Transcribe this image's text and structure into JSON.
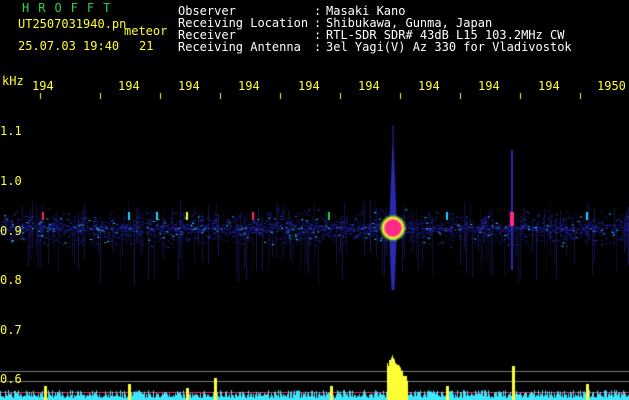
{
  "header": {
    "app_title": "HROFFT",
    "file_name": "UT2507031940.pn",
    "file_suffix": "meteor",
    "timestamp": "25.07.03 19:40",
    "counter": "21",
    "meta": [
      {
        "key": "Observer",
        "value": "Masaki Kano"
      },
      {
        "key": "Receiving Location",
        "value": "Shibukawa, Gunma, Japan"
      },
      {
        "key": "Receiver",
        "value": "RTL-SDR SDR# 43dB L15 103.2MHz CW"
      },
      {
        "key": "Receiving Antenna",
        "value": "3el Yagi(V) Az 330 for Vladivostok"
      }
    ]
  },
  "axes": {
    "y_unit": "kHz",
    "y_ticks": [
      "1.1",
      "1.0",
      "0.9",
      "0.8",
      "0.7",
      "0.6"
    ],
    "x_ticks": [
      "194",
      "194",
      "194",
      "194",
      "194",
      "194",
      "194",
      "194",
      "194",
      "1950"
    ]
  },
  "colors": {
    "text": "#ffff35",
    "title": "#2bd14a",
    "background": "#000000",
    "spectrum": "#3fe6ff",
    "peak": "#ffff35"
  }
}
